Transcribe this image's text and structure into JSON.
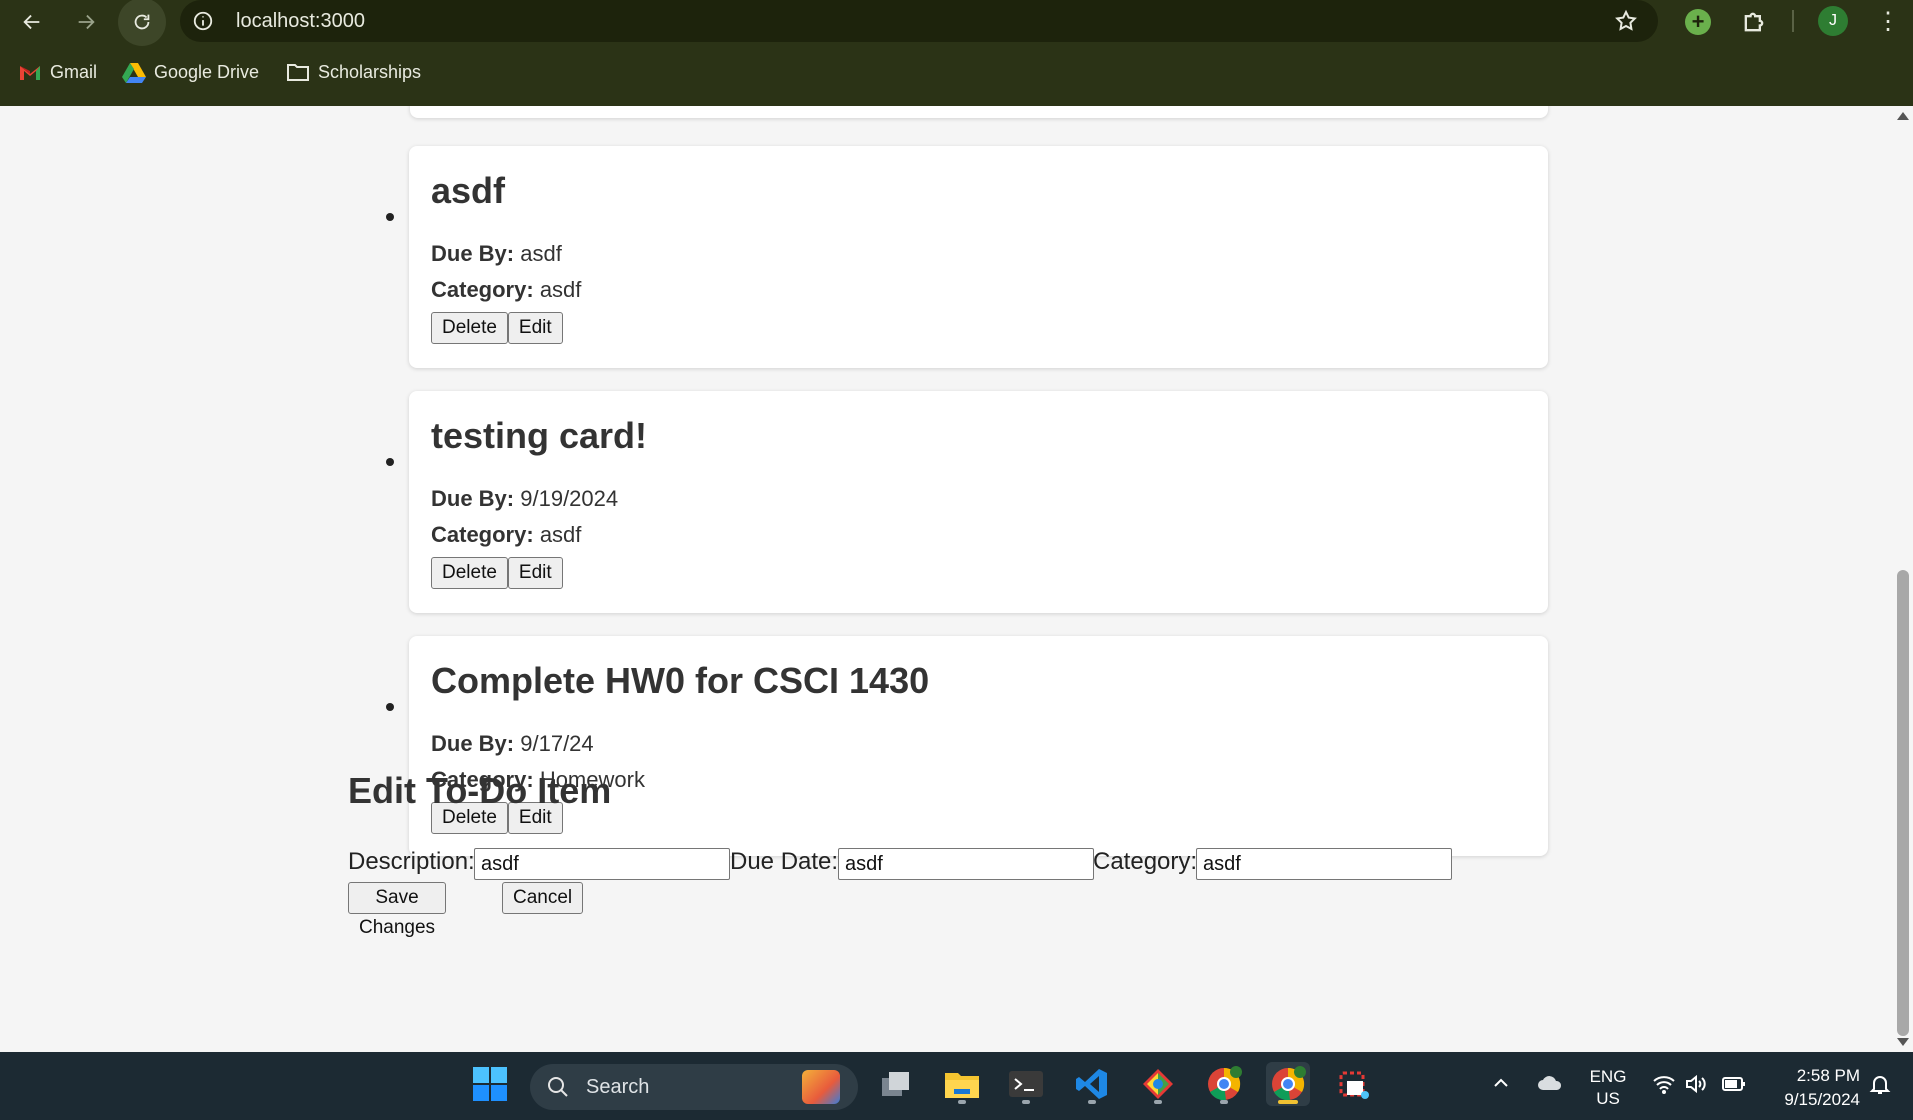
{
  "browser": {
    "url": "localhost:3000",
    "bookmarks": [
      {
        "label": "Gmail"
      },
      {
        "label": "Google Drive"
      },
      {
        "label": "Scholarships"
      }
    ],
    "profile_initial": "J"
  },
  "todos": [
    {
      "title": "asdf",
      "due_label": "Due By:",
      "due": "asdf",
      "category_label": "Category:",
      "category": "asdf"
    },
    {
      "title": "testing card!",
      "due_label": "Due By:",
      "due": "9/19/2024",
      "category_label": "Category:",
      "category": "asdf"
    },
    {
      "title": "Complete HW0 for CSCI 1430",
      "due_label": "Due By:",
      "due": "9/17/24",
      "category_label": "Category:",
      "category": "Homework"
    }
  ],
  "buttons": {
    "delete": "Delete",
    "edit": "Edit"
  },
  "edit_form": {
    "heading": "Edit To-Do Item",
    "description_label": "Description:",
    "description_value": "asdf",
    "due_label": "Due Date:",
    "due_value": "asdf",
    "category_label": "Category:",
    "category_value": "asdf",
    "save_label": "Save Changes",
    "cancel_label": "Cancel"
  },
  "taskbar": {
    "search_placeholder": "Search",
    "lang_line1": "ENG",
    "lang_line2": "US",
    "time": "2:58 PM",
    "date": "9/15/2024"
  }
}
